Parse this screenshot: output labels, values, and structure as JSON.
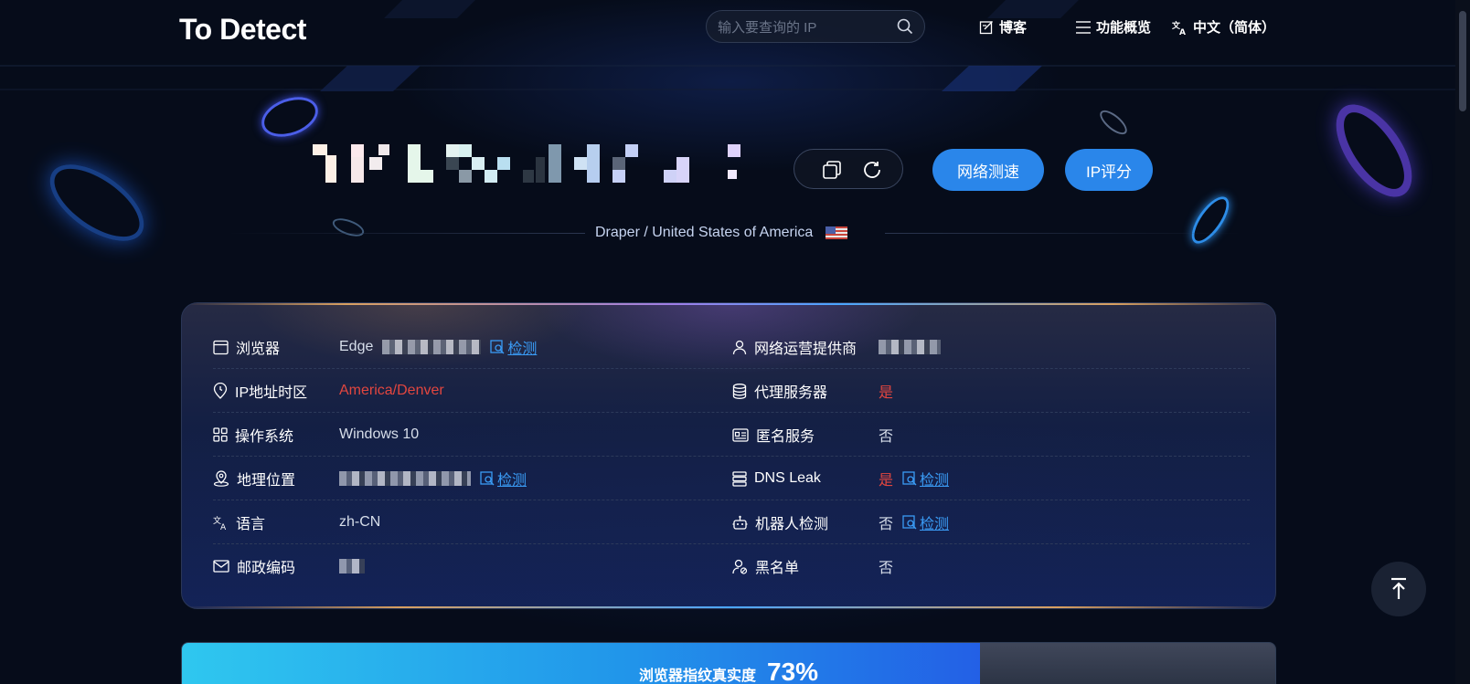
{
  "header": {
    "logo": "To Detect",
    "search_placeholder": "输入要查询的 IP",
    "nav": [
      {
        "label": "博客",
        "icon": "edit-icon"
      },
      {
        "label": "功能概览",
        "icon": "menu-icon"
      },
      {
        "label": "中文（简体）",
        "icon": "translate-icon"
      }
    ]
  },
  "hero": {
    "speed_test_label": "网络测速",
    "ip_score_label": "IP评分",
    "location": "Draper / United States of America",
    "colors": {
      "accent": "#2a86ea"
    }
  },
  "info": {
    "detect_label": "检测",
    "left": [
      {
        "label": "浏览器",
        "icon": "browser-icon",
        "value": "Edge",
        "detect": true
      },
      {
        "label": "IP地址时区",
        "icon": "clock-pin-icon",
        "value": "America/Denver",
        "red": true
      },
      {
        "label": "操作系统",
        "icon": "grid-icon",
        "value": "Windows 10"
      },
      {
        "label": "地理位置",
        "icon": "location-icon",
        "value": "",
        "detect": true
      },
      {
        "label": "语言",
        "icon": "translate-icon",
        "value": "zh-CN"
      },
      {
        "label": "邮政编码",
        "icon": "mail-icon",
        "value": ""
      }
    ],
    "right": [
      {
        "label": "网络运营提供商",
        "icon": "user-icon",
        "value": ""
      },
      {
        "label": "代理服务器",
        "icon": "database-icon",
        "value": "是",
        "red": true
      },
      {
        "label": "匿名服务",
        "icon": "id-card-icon",
        "value": "否"
      },
      {
        "label": "DNS Leak",
        "icon": "server-icon",
        "value": "是",
        "red": true,
        "detect": true
      },
      {
        "label": "机器人检测",
        "icon": "robot-icon",
        "value": "否",
        "detect": true
      },
      {
        "label": "黑名单",
        "icon": "user-block-icon",
        "value": "否"
      }
    ]
  },
  "fingerprint": {
    "label": "浏览器指纹真实度",
    "percent_text": "73%",
    "percent": 73
  }
}
